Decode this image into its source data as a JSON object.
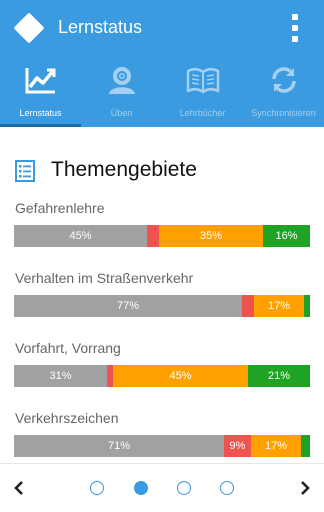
{
  "app": {
    "title": "Lernstatus"
  },
  "tabs": [
    {
      "label": "Lernstatus",
      "icon": "trend-chart-icon",
      "active": true
    },
    {
      "label": "Üben",
      "icon": "gear-head-icon",
      "active": false
    },
    {
      "label": "Lehrbücher",
      "icon": "open-book-icon",
      "active": false
    },
    {
      "label": "Synchronisieren",
      "icon": "sync-icon",
      "active": false
    }
  ],
  "section": {
    "title": "Themengebiete",
    "icon": "list-icon"
  },
  "colors": {
    "primary": "#3a9be0",
    "gray": "#a1a1a1",
    "red": "#ef5350",
    "orange": "#ffa000",
    "green": "#1fa325"
  },
  "topics": [
    {
      "name": "Gefahrenlehre",
      "segments": [
        {
          "label": "45%",
          "value": 45,
          "color": "gray"
        },
        {
          "label": "",
          "value": 4,
          "color": "red"
        },
        {
          "label": "35%",
          "value": 35,
          "color": "orange"
        },
        {
          "label": "16%",
          "value": 16,
          "color": "green"
        }
      ]
    },
    {
      "name": "Verhalten im Straßenverkehr",
      "segments": [
        {
          "label": "77%",
          "value": 77,
          "color": "gray"
        },
        {
          "label": "",
          "value": 4,
          "color": "red"
        },
        {
          "label": "17%",
          "value": 17,
          "color": "orange"
        },
        {
          "label": "",
          "value": 2,
          "color": "green"
        }
      ]
    },
    {
      "name": "Vorfahrt, Vorrang",
      "segments": [
        {
          "label": "31%",
          "value": 31,
          "color": "gray"
        },
        {
          "label": "",
          "value": 2,
          "color": "red"
        },
        {
          "label": "45%",
          "value": 45,
          "color": "orange"
        },
        {
          "label": "21%",
          "value": 21,
          "color": "green"
        }
      ]
    },
    {
      "name": "Verkehrszeichen",
      "segments": [
        {
          "label": "71%",
          "value": 71,
          "color": "gray"
        },
        {
          "label": "9%",
          "value": 9,
          "color": "red"
        },
        {
          "label": "17%",
          "value": 17,
          "color": "orange"
        },
        {
          "label": "",
          "value": 3,
          "color": "green"
        }
      ]
    }
  ],
  "pager": {
    "pages": 4,
    "current": 2
  }
}
